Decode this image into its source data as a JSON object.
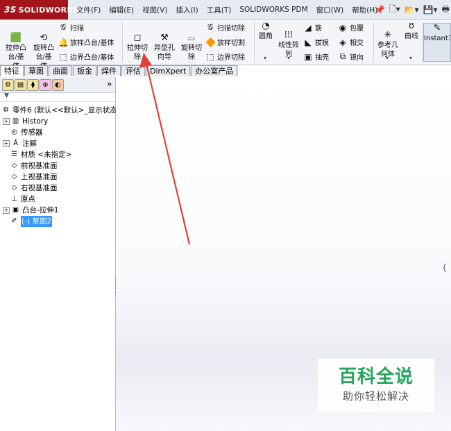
{
  "app": {
    "logo_prefix": "3S",
    "logo_text": "SOLIDWORKS"
  },
  "menu": [
    "文件(F)",
    "编辑(E)",
    "视图(V)",
    "插入(I)",
    "工具(T)",
    "SOLIDWORKS PDM",
    "窗口(W)",
    "帮助(H)"
  ],
  "quick_icons": [
    "pin-icon",
    "new-document-icon",
    "open-folder-icon",
    "save-icon",
    "print-icon"
  ],
  "commands": {
    "extrude_boss": "拉伸凸\n台/基\n体",
    "revolve_boss": "旋转凸\n台/基\n体",
    "sweep": "扫描",
    "loft_boss": "放样凸台/基体",
    "boundary_boss": "边界凸台/基体",
    "extrude_cut": "拉伸切\n除",
    "hole_wizard": "异型孔\n向导",
    "revolve_cut": "旋转切\n除",
    "sweep_cut": "扫描切除",
    "loft_cut": "放样切割",
    "boundary_cut": "边界切除",
    "fillet": "圆角",
    "linear_pattern": "线性阵\n列",
    "rib": "筋",
    "draft": "拔模",
    "shell": "抽壳",
    "wrap": "包覆",
    "intersect": "相交",
    "mirror": "镜向",
    "ref_geometry": "参考几\n何体",
    "curves": "曲线",
    "instant3d": "Instant3"
  },
  "tabs": [
    "特征",
    "草图",
    "曲面",
    "钣金",
    "焊件",
    "评估",
    "DimXpert",
    "办公室产品"
  ],
  "tree": {
    "root": "零件6  (默认<<默认>_显示状态",
    "items": [
      "History",
      "传感器",
      "注解",
      "材质 <未指定>",
      "前视基准面",
      "上视基准面",
      "右视基准面",
      "原点",
      "凸台-拉伸1",
      "(-) 草图2"
    ]
  },
  "pane_collapse": "»",
  "watermark": {
    "title": "百科全说",
    "subtitle": "助你轻松解决"
  },
  "colors": {
    "logo_bg": "#a3141b",
    "selection": "#3399ff",
    "annotation_arrow": "#e0403a",
    "watermark_green": "#23a45a"
  }
}
